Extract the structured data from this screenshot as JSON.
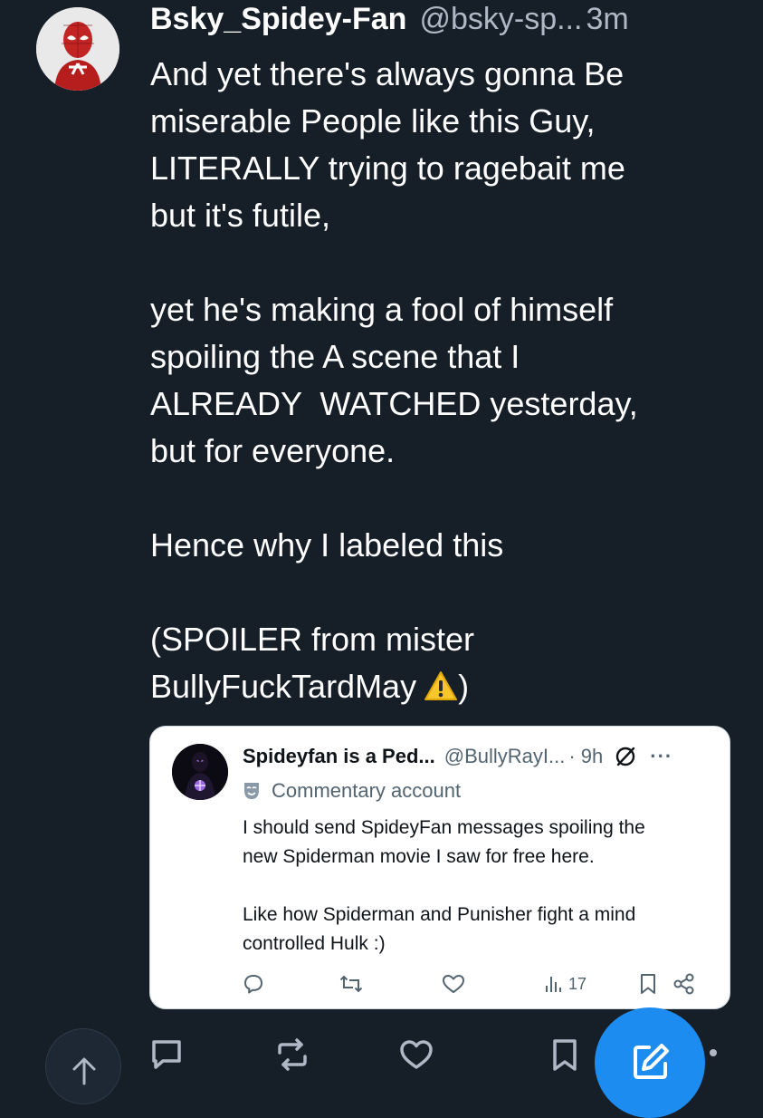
{
  "post": {
    "display_name": "Bsky_Spidey-Fan",
    "handle": "@bsky-sp...",
    "time": "3m",
    "body_paragraphs": [
      [
        "And yet there's always gonna Be",
        "miserable People like this Guy,",
        "LITERALLY trying to ragebait me",
        "but it's futile,"
      ],
      [
        "yet he's making a fool of himself",
        "spoiling the A scene that I",
        "ALREADY  WATCHED yesterday,",
        "but for everyone."
      ],
      [
        "Hence why I labeled this"
      ],
      [
        "(SPOILER from mister",
        "BullyFuckTardMay",
        ")"
      ]
    ],
    "warning_emoji_color": "#f7c62f"
  },
  "quote": {
    "display_name": "Spideyfan is a Ped...",
    "handle": "@BullyRayI...",
    "time": "· 9h",
    "more": "···",
    "account_label": "Commentary account",
    "body_paragraphs": [
      [
        "I should send SpideyFan messages spoiling the",
        "new Spiderman movie I saw for free here."
      ],
      [
        "Like how Spiderman and Punisher fight a mind",
        "controlled Hulk :)"
      ]
    ],
    "views": "17",
    "icons": [
      "reply-icon",
      "repost-icon",
      "like-icon",
      "views-icon",
      "bookmark-icon",
      "share-icon"
    ]
  },
  "bottom_bar": {
    "icons": [
      "scroll-top-icon",
      "reply-icon",
      "repost-icon",
      "like-icon",
      "bookmark-icon",
      "compose-icon",
      "more-icon"
    ],
    "accent_color": "#1d8cf0"
  },
  "theme": {
    "background": "#161e27",
    "muted_text": "#aeb9c5"
  }
}
